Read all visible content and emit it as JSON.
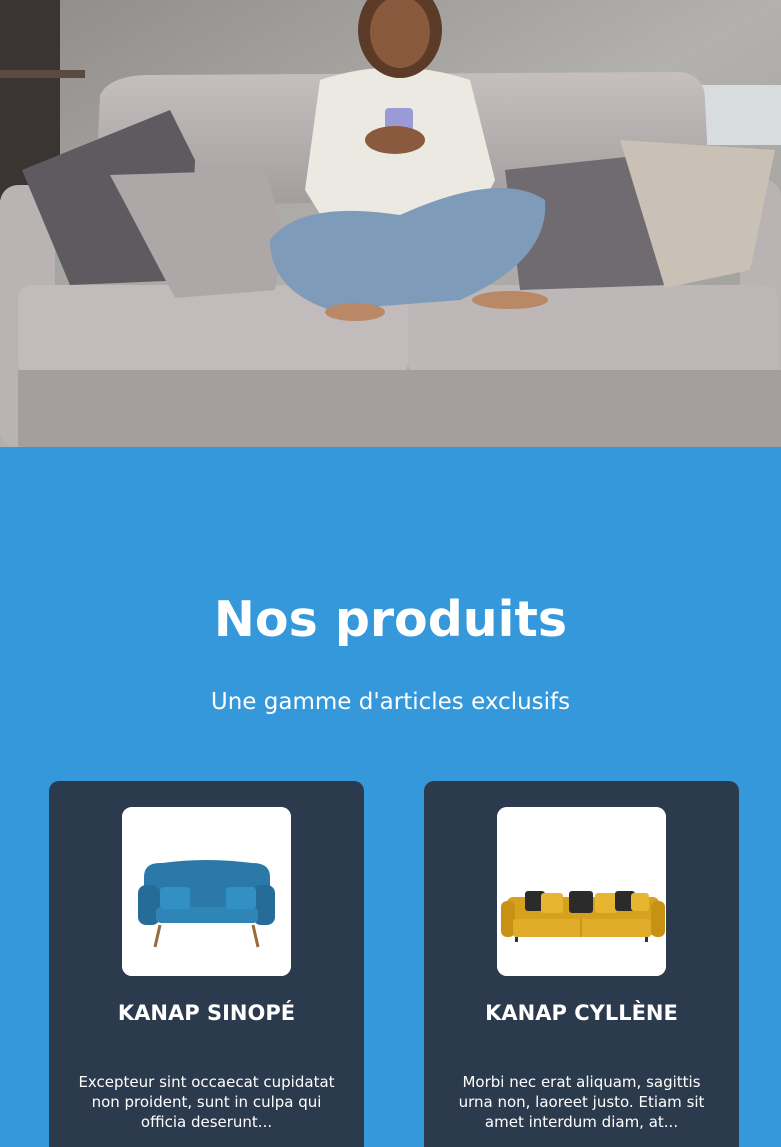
{
  "hero": {
    "image": "woman-on-sofa-with-phone"
  },
  "products_section": {
    "title": "Nos produits",
    "subtitle": "Une gamme d'articles exclusifs",
    "items": [
      {
        "name": "KANAP SINOPÉ",
        "description": "Excepteur sint occaecat cupidatat non proident, sunt in culpa qui officia deserunt...",
        "image": "blue-sofa-image"
      },
      {
        "name": "KANAP CYLLÈNE",
        "description": "Morbi nec erat aliquam, sagittis urna non, laoreet justo. Etiam sit amet interdum diam, at...",
        "image": "yellow-sofa-image"
      }
    ]
  },
  "colors": {
    "section_bg": "#3498db",
    "card_bg": "#2c3a4e",
    "text": "#ffffff"
  }
}
